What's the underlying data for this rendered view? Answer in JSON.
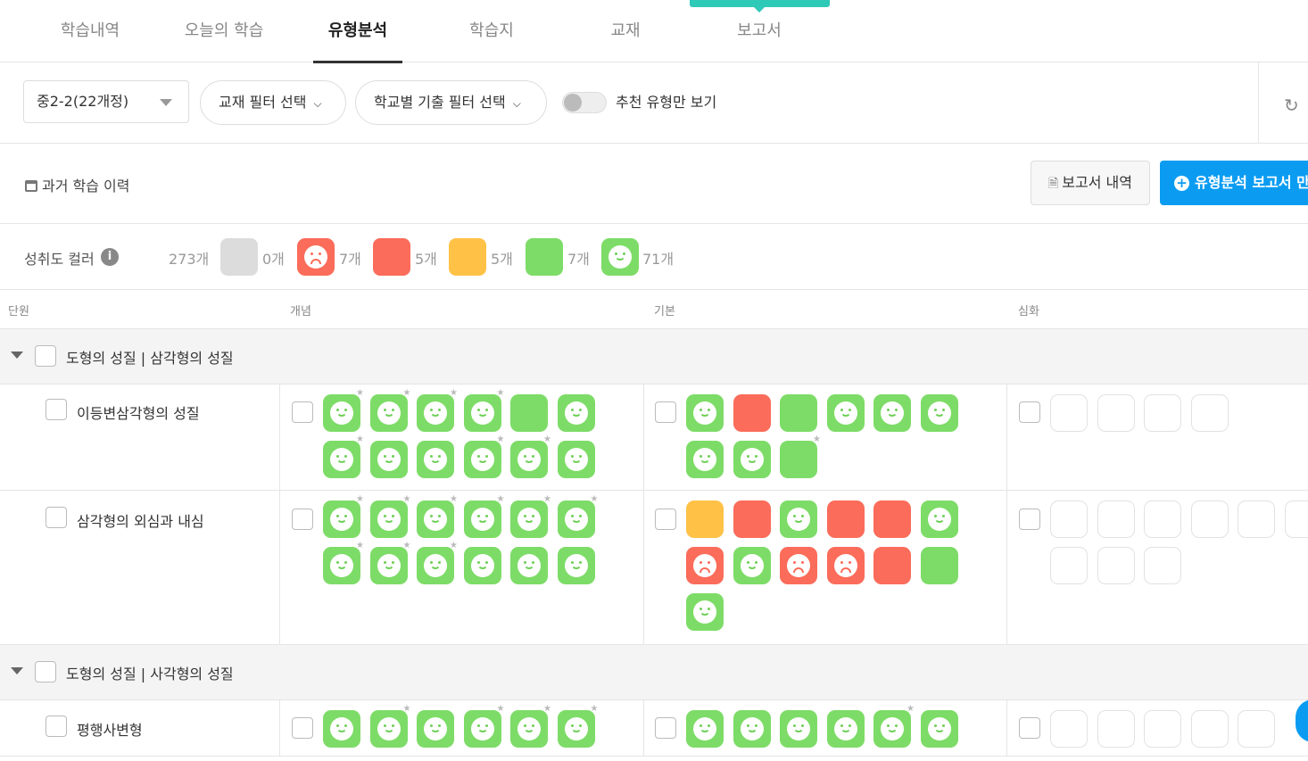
{
  "tabs": [
    {
      "label": "학습내역",
      "active": false
    },
    {
      "label": "오늘의 학습",
      "active": false
    },
    {
      "label": "유형분석",
      "active": true
    },
    {
      "label": "학습지",
      "active": false
    },
    {
      "label": "교재",
      "active": false
    },
    {
      "label": "보고서",
      "active": false
    }
  ],
  "filters": {
    "grade_select": "중2-2(22개정)",
    "textbook_filter": "교재 필터 선택",
    "school_filter": "학교별 기출 필터 선택",
    "recommend_toggle_label": "추천 유형만 보기",
    "recommend_toggle_on": false
  },
  "toolbar": {
    "history_label": "과거 학습 이력",
    "report_list_label": "보고서 내역",
    "make_report_label": "유형분석 보고서 만"
  },
  "legend": {
    "label": "성취도 컬러",
    "items": [
      {
        "type": "empty",
        "count": "273개"
      },
      {
        "type": "gray",
        "count": "0개"
      },
      {
        "type": "red-face",
        "count": "7개"
      },
      {
        "type": "red",
        "count": "5개"
      },
      {
        "type": "orange",
        "count": "5개"
      },
      {
        "type": "green",
        "count": "7개"
      },
      {
        "type": "green-face",
        "count": "71개"
      }
    ]
  },
  "columns": {
    "unit": "단원",
    "concept": "개념",
    "basic": "기본",
    "advanced": "심화"
  },
  "colors": {
    "green": "#7ddc67",
    "red": "#fb6c5a",
    "orange": "#ffc247",
    "gray": "#dcdcdc",
    "primary": "#0b9cf2",
    "teal": "#2ec9b7"
  },
  "units": [
    {
      "title": "도형의 성질 | 삼각형의 성질",
      "topics": [
        {
          "name": "이등변삼각형의 성질",
          "concept": [
            [
              "gs",
              1
            ],
            [
              "gs",
              1
            ],
            [
              "gs",
              1
            ],
            [
              "gs",
              1
            ],
            [
              "g",
              0
            ],
            [
              "gs",
              0
            ],
            [
              "gs",
              1
            ],
            [
              "gs",
              0
            ],
            [
              "gs",
              0
            ],
            [
              "gs",
              1
            ],
            [
              "gs",
              1
            ],
            [
              "gs",
              0
            ]
          ],
          "basic": [
            [
              "gs",
              0
            ],
            [
              "r",
              0
            ],
            [
              "g",
              0
            ],
            [
              "gs",
              0
            ],
            [
              "gs",
              0
            ],
            [
              "gs",
              0
            ],
            [
              "gs",
              0
            ],
            [
              "gs",
              0
            ],
            [
              "g",
              1
            ]
          ],
          "advanced": [
            [
              "e",
              0
            ],
            [
              "e",
              0
            ],
            [
              "e",
              0
            ],
            [
              "e",
              0
            ]
          ]
        },
        {
          "name": "삼각형의 외심과 내심",
          "concept": [
            [
              "gs",
              1
            ],
            [
              "gs",
              1
            ],
            [
              "gs",
              1
            ],
            [
              "gs",
              1
            ],
            [
              "gs",
              1
            ],
            [
              "gs",
              1
            ],
            [
              "gs",
              1
            ],
            [
              "gs",
              1
            ],
            [
              "gs",
              1
            ],
            [
              "gs",
              0
            ],
            [
              "gs",
              0
            ],
            [
              "gs",
              0
            ]
          ],
          "basic": [
            [
              "o",
              0
            ],
            [
              "r",
              0
            ],
            [
              "gs",
              0
            ],
            [
              "r",
              0
            ],
            [
              "r",
              0
            ],
            [
              "gs",
              0
            ],
            [
              "rs",
              0
            ],
            [
              "gs",
              0
            ],
            [
              "rs",
              0
            ],
            [
              "rs",
              0
            ],
            [
              "r",
              0
            ],
            [
              "g",
              0
            ],
            [
              "gs",
              0
            ]
          ],
          "advanced": [
            [
              "e",
              0
            ],
            [
              "e",
              0
            ],
            [
              "e",
              0
            ],
            [
              "e",
              0
            ],
            [
              "e",
              0
            ],
            [
              "e",
              0
            ],
            [
              "e",
              0
            ],
            [
              "e",
              0
            ],
            [
              "e",
              0
            ]
          ]
        }
      ]
    },
    {
      "title": "도형의 성질 | 사각형의 성질",
      "topics": [
        {
          "name": "평행사변형",
          "concept": [
            [
              "gs",
              0
            ],
            [
              "gs",
              1
            ],
            [
              "gs",
              0
            ],
            [
              "gs",
              1
            ],
            [
              "gs",
              1
            ],
            [
              "gs",
              1
            ]
          ],
          "basic": [
            [
              "gs",
              0
            ],
            [
              "gs",
              0
            ],
            [
              "gs",
              0
            ],
            [
              "gs",
              0
            ],
            [
              "gs",
              1
            ],
            [
              "gs",
              0
            ]
          ],
          "advanced": [
            [
              "e",
              0
            ],
            [
              "e",
              0
            ],
            [
              "e",
              0
            ],
            [
              "e",
              0
            ],
            [
              "e",
              0
            ]
          ]
        }
      ]
    }
  ]
}
